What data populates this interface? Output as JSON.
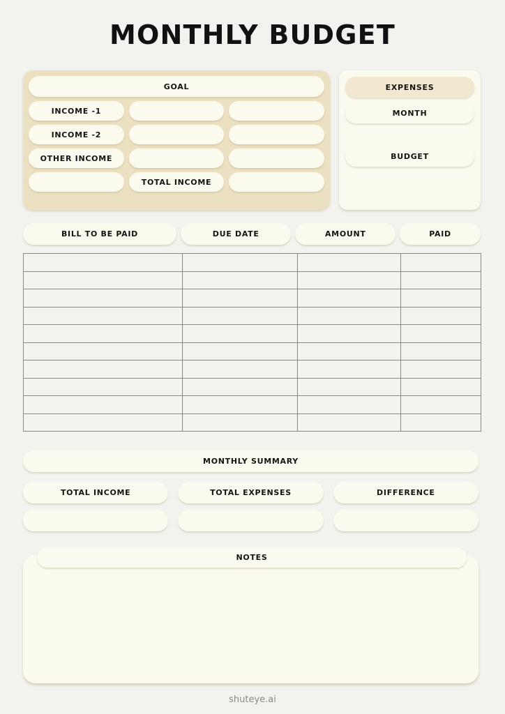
{
  "page": {
    "title": "MONTHLY BUDGET",
    "footer": "shuteye.ai",
    "colors": {
      "background": "#f2f2ee",
      "panel_tan": "#ece0c2",
      "pill_cream": "#fbfaef",
      "pill_tan": "#f1e8cf",
      "text": "#141414",
      "table_border": "#8a8a85",
      "footer_text": "#8a8a85"
    }
  },
  "goal_panel": {
    "header": "GOAL",
    "rows": [
      {
        "label": "INCOME -1",
        "value_1": "",
        "value_2": ""
      },
      {
        "label": "INCOME -2",
        "value_1": "",
        "value_2": ""
      },
      {
        "label": "OTHER INCOME",
        "value_1": "",
        "value_2": ""
      },
      {
        "label": "",
        "value_1": "TOTAL INCOME",
        "value_2": ""
      }
    ]
  },
  "expenses_panel": {
    "header": "EXPENSES",
    "month_label": "MONTH",
    "budget_label": "BUDGET"
  },
  "bills_table": {
    "columns": [
      "BILL TO BE PAID",
      "DUE DATE",
      "AMOUNT",
      "PAID"
    ],
    "row_count": 10,
    "rows": [
      [
        "",
        "",
        "",
        ""
      ],
      [
        "",
        "",
        "",
        ""
      ],
      [
        "",
        "",
        "",
        ""
      ],
      [
        "",
        "",
        "",
        ""
      ],
      [
        "",
        "",
        "",
        ""
      ],
      [
        "",
        "",
        "",
        ""
      ],
      [
        "",
        "",
        "",
        ""
      ],
      [
        "",
        "",
        "",
        ""
      ],
      [
        "",
        "",
        "",
        ""
      ],
      [
        "",
        "",
        "",
        ""
      ]
    ]
  },
  "monthly_summary": {
    "header": "MONTHLY SUMMARY",
    "items": [
      {
        "label": "TOTAL INCOME",
        "value": ""
      },
      {
        "label": "TOTAL EXPENSES",
        "value": ""
      },
      {
        "label": "DIFFERENCE",
        "value": ""
      }
    ]
  },
  "notes": {
    "header": "NOTES",
    "content": ""
  }
}
